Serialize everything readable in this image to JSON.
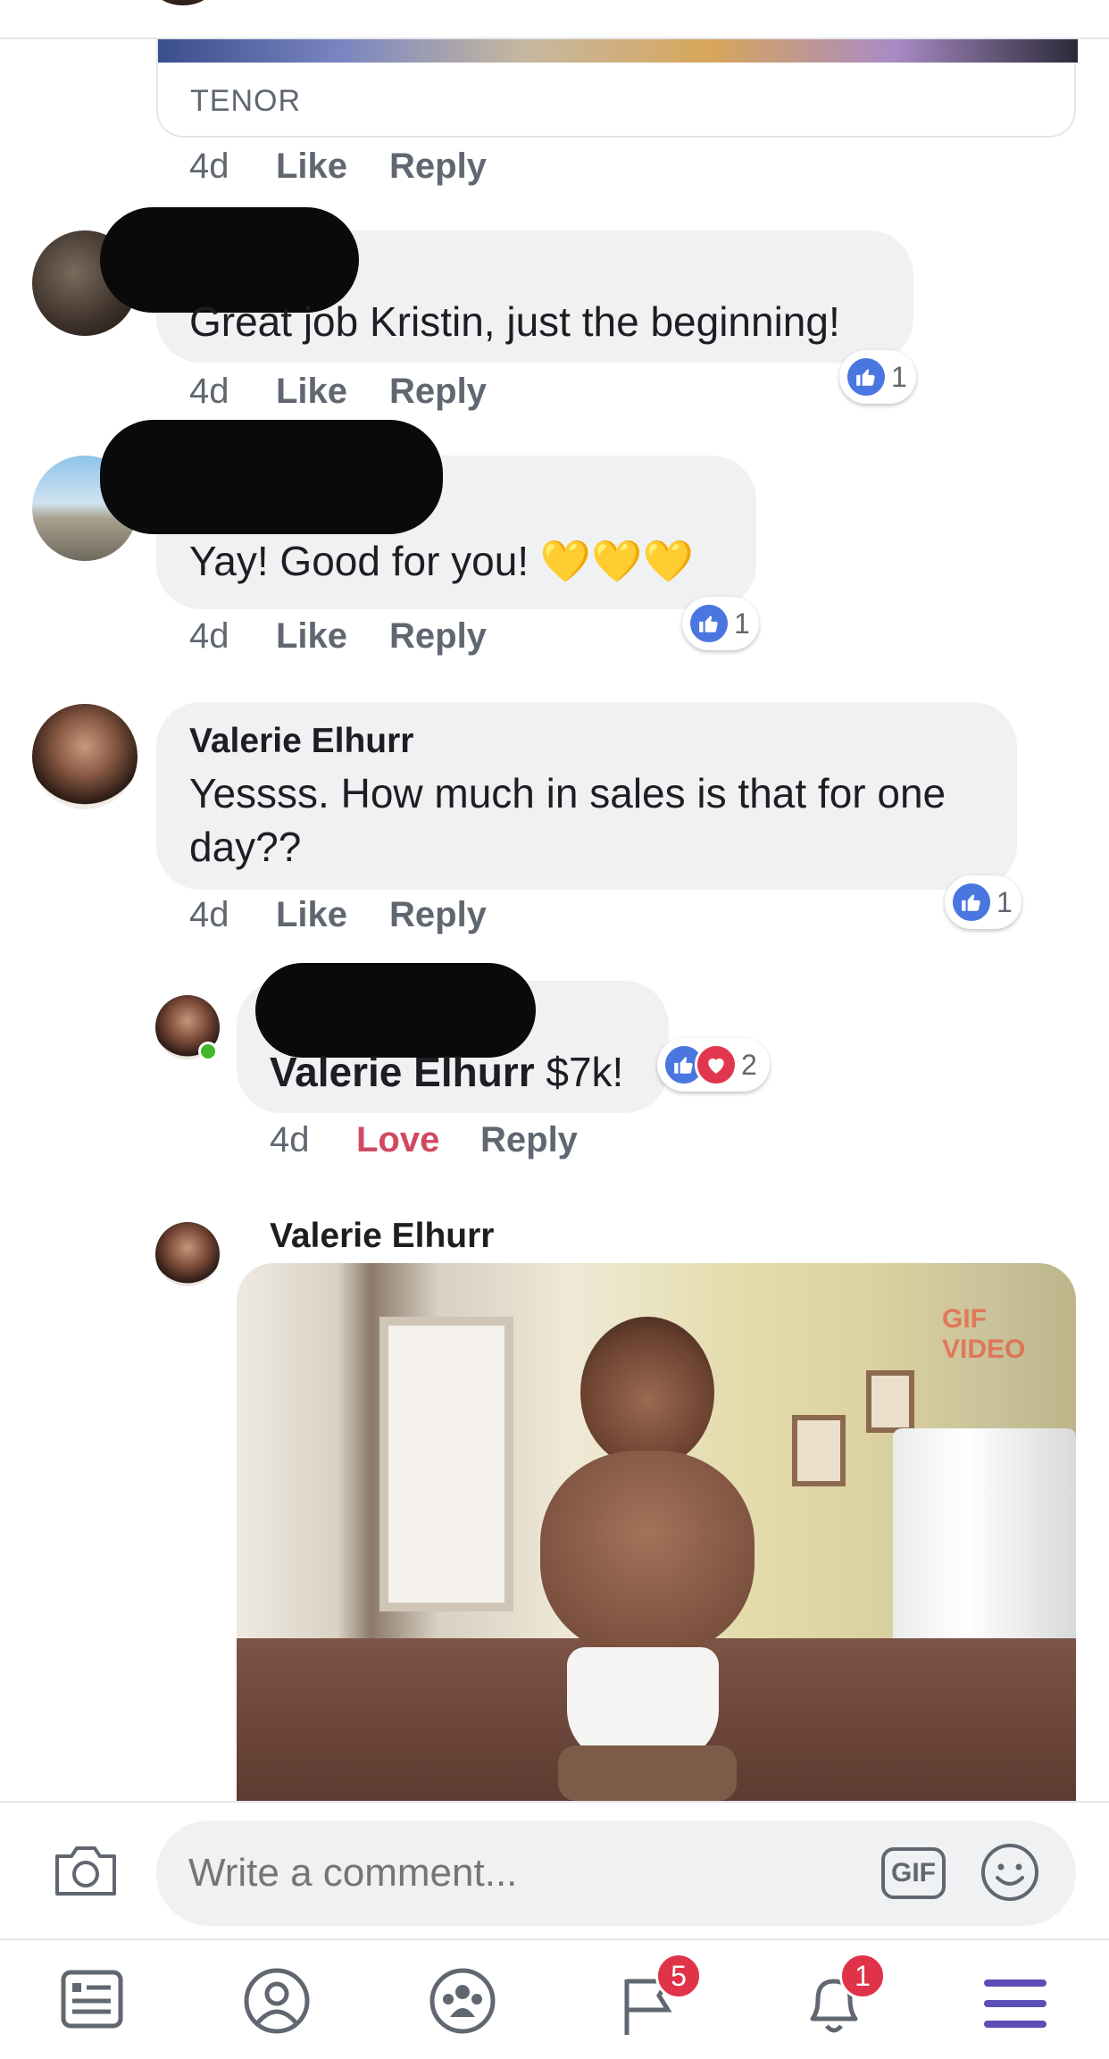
{
  "gif_card": {
    "source_label": "TENOR"
  },
  "comments": [
    {
      "time": "4d",
      "like": "Like",
      "reply": "Reply"
    },
    {
      "text": "Great job Kristin, just the beginning!",
      "time": "4d",
      "like": "Like",
      "reply": "Reply",
      "reaction_count": "1"
    },
    {
      "text": "Yay! Good for you! 💛💛💛",
      "time": "4d",
      "like": "Like",
      "reply": "Reply",
      "reaction_count": "1"
    },
    {
      "author": "Valerie Elhurr",
      "text": "Yessss. How much in sales is that for one day??",
      "time": "4d",
      "like": "Like",
      "reply": "Reply",
      "reaction_count": "1"
    }
  ],
  "reply": {
    "mention": "Valerie Elhurr",
    "text": " $7k!",
    "time": "4d",
    "love": "Love",
    "reply_label": "Reply",
    "reaction_count": "2"
  },
  "gif_reply": {
    "author": "Valerie Elhurr",
    "watermark": "GIF VIDEO"
  },
  "composer": {
    "placeholder": "Write a comment...",
    "gif_label": "GIF"
  },
  "tabbar": {
    "flag_badge": "5",
    "notifications_badge": "1"
  },
  "colors": {
    "like_blue": "#4a76e0",
    "love_red": "#e0374f",
    "accent_purple": "#5b4fb7",
    "badge_red": "#e0334a"
  }
}
